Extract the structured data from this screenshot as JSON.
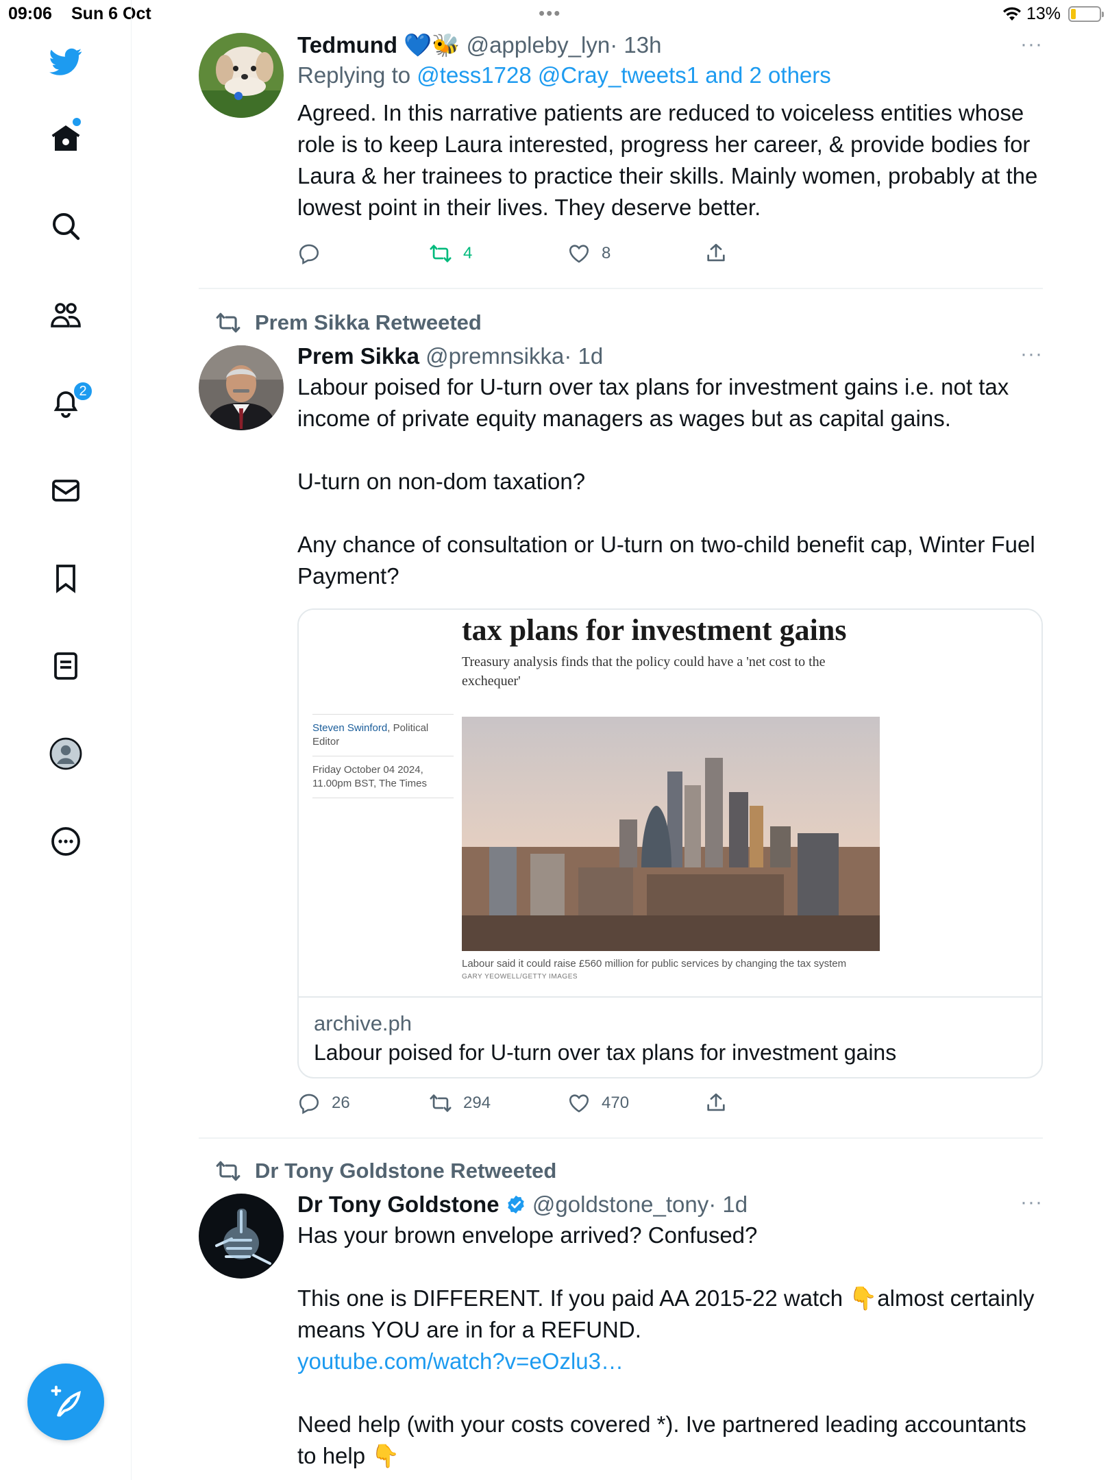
{
  "status_bar": {
    "time": "09:06",
    "date": "Sun 6 Oct",
    "battery": "13%",
    "battery_level": 0.13
  },
  "sidebar": {
    "items": [
      "twitter-logo",
      "home-icon",
      "search-icon",
      "communities-icon",
      "notifications-icon",
      "messages-icon",
      "bookmarks-icon",
      "lists-icon",
      "profile-icon",
      "more-icon"
    ],
    "notification_count": "2"
  },
  "tweets": [
    {
      "name": "Tedmund",
      "emoji": "💙🐝",
      "handle": "@appleby_lyn",
      "time": "· 13h",
      "reply_prefix": "Replying to",
      "reply_to": "@tess1728 @Cray_tweets1 and 2 others",
      "text": "Agreed. In this narrative patients are reduced to voiceless entities whose role is to keep Laura interested, progress her career, & provide bodies for Laura & her trainees to practice their skills. Mainly women, probably at the lowest point in their lives. They deserve better.",
      "replies": "",
      "retweets": "4",
      "likes": "8",
      "more": "···"
    },
    {
      "retweeted_by": "Prem Sikka Retweeted",
      "name": "Prem Sikka",
      "handle": "@premnsikka",
      "time": "· 1d",
      "text_1": "Labour poised for U-turn over tax plans for investment gains i.e. not tax income of private equity managers as wages but as capital gains.",
      "text_2": "U-turn on non-dom taxation?",
      "text_3": "Any chance of consultation or U-turn on two-child benefit cap, Winter Fuel Payment?",
      "card": {
        "article_title": "tax plans for investment gains",
        "article_subtitle": "Treasury analysis finds that the policy could have a 'net cost to the exchequer'",
        "author": "Steven Swinford",
        "author_role": ", Political Editor",
        "date": "Friday October 04 2024, 11.00pm BST, The Times",
        "caption": "Labour said it could raise £560 million for public services by changing the tax system",
        "credit": "GARY YEOWELL/GETTY IMAGES",
        "domain": "archive.ph",
        "title": "Labour poised for U-turn over tax plans for investment gains"
      },
      "replies": "26",
      "retweets": "294",
      "likes": "470",
      "more": "···"
    },
    {
      "retweeted_by": "Dr Tony Goldstone Retweeted",
      "name": "Dr Tony Goldstone",
      "handle": "@goldstone_tony",
      "time": "· 1d",
      "text_1": "Has your brown envelope arrived? Confused?",
      "text_2a": "This one is DIFFERENT. If you paid AA 2015-22 watch 👇almost certainly means YOU are in for a REFUND.",
      "link": "youtube.com/watch?v=eOzlu3…",
      "text_3": "Need help (with your costs covered *). Ive partnered leading accountants to help 👇",
      "more": "···"
    }
  ]
}
